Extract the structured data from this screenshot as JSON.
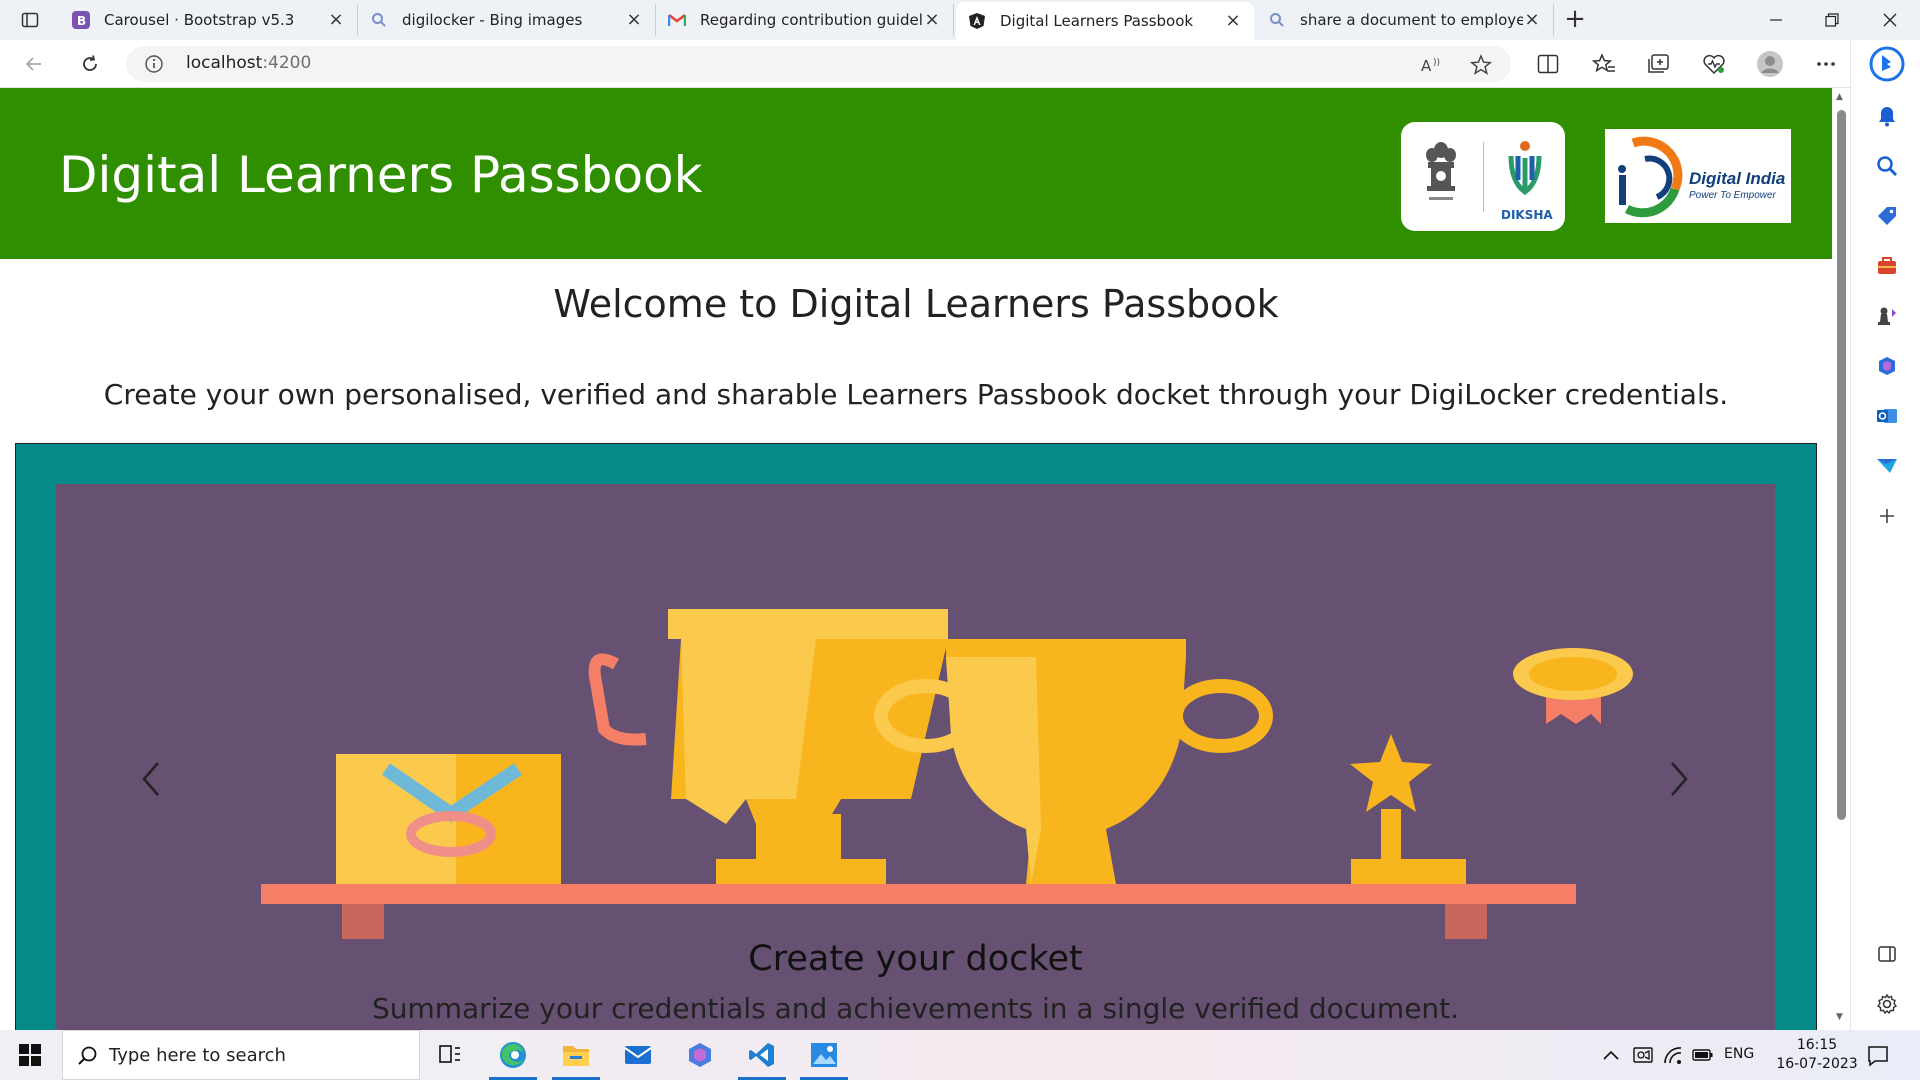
{
  "browser": {
    "tabs": [
      {
        "title": "Carousel · Bootstrap v5.3",
        "icon": "bootstrap-icon",
        "active": false
      },
      {
        "title": "digilocker - Bing images",
        "icon": "bing-search-icon",
        "active": false
      },
      {
        "title": "Regarding contribution guideline",
        "icon": "gmail-icon",
        "active": false
      },
      {
        "title": "Digital Learners Passbook",
        "icon": "angular-icon",
        "active": true
      },
      {
        "title": "share a document to employers",
        "icon": "bing-search-icon",
        "active": false
      }
    ],
    "address": {
      "host": "localhost",
      "port": ":4200"
    }
  },
  "page": {
    "header": {
      "title": "Digital Learners Passbook",
      "logo_left_text": "DIKSHA",
      "logo_right_text": "Digital India",
      "logo_right_tagline": "Power To Empower"
    },
    "welcome": "Welcome to Digital Learners Passbook",
    "subtitle": "Create your own personalised, verified and sharable Learners Passbook docket through your DigiLocker credentials.",
    "carousel": {
      "caption_title": "Create your docket",
      "caption_text": "Summarize your credentials and achievements in a single verified document."
    }
  },
  "taskbar": {
    "search_placeholder": "Type here to search",
    "language": "ENG",
    "time": "16:15",
    "date": "16-07-2023"
  },
  "colors": {
    "header_green": "#2f8f00",
    "carousel_teal": "#058a8a",
    "slide_purple": "#675172",
    "trophy_gold": "#f9b51e"
  }
}
